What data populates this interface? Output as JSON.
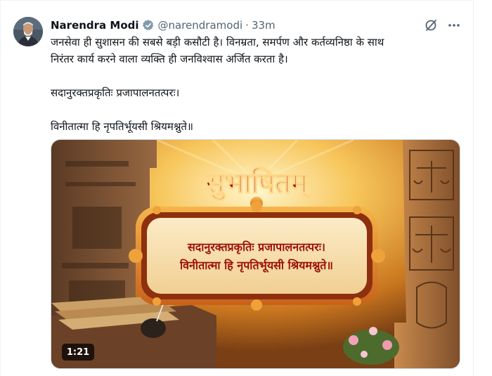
{
  "tweet": {
    "author_name": "Narendra Modi",
    "handle": "@narendramodi",
    "separator": "·",
    "time": "33m",
    "text_line1": "जनसेवा ही सुशासन की सबसे बड़ी कसौटी है। विनम्रता, समर्पण और कर्तव्यनिष्ठा के साथ",
    "text_line2": "निरंतर कार्य करने वाला व्यक्ति ही जनविश्वास अर्जित करता है।",
    "text_para2": "सदानुरक्तप्रकृतिः प्रजापालनतत्परः।",
    "text_para3": "विनीतात्मा हि नृपतिर्भूयसी श्रियमश्नुते॥"
  },
  "media": {
    "title": "सुभाषितम्",
    "verse_line1": "सदानुरक्तप्रकृतिः प्रजापालनतत्परः।",
    "verse_line2": "विनीतात्मा हि नृपतिर्भूयसी श्रियमश्नुते॥",
    "duration": "1:21"
  },
  "icons": {
    "verified": "verified-badge-icon",
    "grok": "grok-icon",
    "more": "more-icon"
  },
  "colors": {
    "verified": "#829aab",
    "handle": "#536471",
    "text": "#0f1419"
  }
}
